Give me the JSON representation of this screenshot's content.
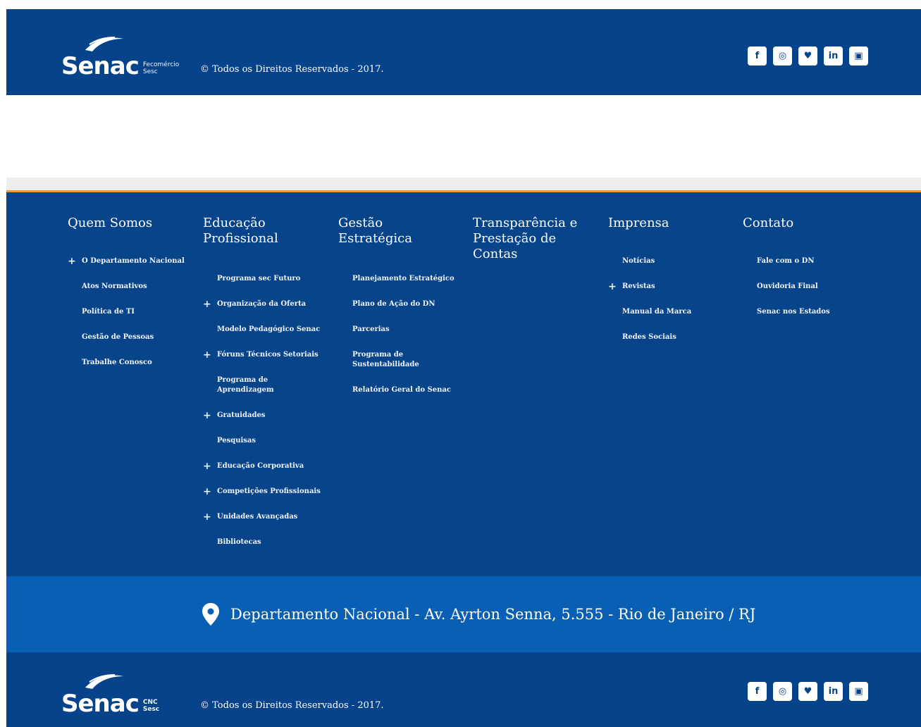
{
  "brand": {
    "name": "Senac",
    "top_sub": [
      "Fecomércio",
      "Sesc"
    ],
    "bottom_sub": [
      "CNC",
      "Sesc"
    ],
    "copyright": "© Todos os Direitos Reservados - 2017."
  },
  "social": [
    {
      "icon": "facebook-icon",
      "glyph": "f"
    },
    {
      "icon": "instagram-icon",
      "glyph": "◎"
    },
    {
      "icon": "twitter-icon",
      "glyph": "♥"
    },
    {
      "icon": "linkedin-icon",
      "glyph": "in"
    },
    {
      "icon": "youtube-icon",
      "glyph": "▣"
    }
  ],
  "colors": {
    "primary": "#06438a",
    "address_bar": "#085fb4",
    "accent": "#f39a31"
  },
  "columns": [
    {
      "title": "Quem Somos",
      "items": [
        {
          "label": "O Departamento Nacional",
          "expandable": true
        },
        {
          "label": "Atos Normativos",
          "expandable": false
        },
        {
          "label": "Política de TI",
          "expandable": false
        },
        {
          "label": "Gestão de Pessoas",
          "expandable": false
        },
        {
          "label": "Trabalhe Conosco",
          "expandable": false
        }
      ]
    },
    {
      "title": "Educação\nProfissional",
      "items": [
        {
          "label": "Programa sec Futuro",
          "expandable": false
        },
        {
          "label": "Organização da Oferta",
          "expandable": true
        },
        {
          "label": "Modelo Pedagógico Senac",
          "expandable": false
        },
        {
          "label": "Fóruns Técnicos Setoriais",
          "expandable": true
        },
        {
          "label": "Programa de\nAprendizagem",
          "expandable": false
        },
        {
          "label": "Gratuidades",
          "expandable": true
        },
        {
          "label": "Pesquisas",
          "expandable": false
        },
        {
          "label": "Educação Corporativa",
          "expandable": true
        },
        {
          "label": "Competições Profissionais",
          "expandable": true
        },
        {
          "label": "Unidades Avançadas",
          "expandable": true
        },
        {
          "label": "Bibliotecas",
          "expandable": false
        }
      ]
    },
    {
      "title": "Gestão\nEstratégica",
      "items": [
        {
          "label": "Planejamento Estratégico",
          "expandable": false
        },
        {
          "label": "Plano de Ação do DN",
          "expandable": false
        },
        {
          "label": "Parcerias",
          "expandable": false
        },
        {
          "label": "Programa de\nSustentabilidade",
          "expandable": false
        },
        {
          "label": "Relatório Geral do Senac",
          "expandable": false
        }
      ]
    },
    {
      "title": "Transparência e\nPrestação de\nContas",
      "items": []
    },
    {
      "title": "Imprensa",
      "items": [
        {
          "label": "Notícias",
          "expandable": false
        },
        {
          "label": "Revistas",
          "expandable": true
        },
        {
          "label": "Manual da Marca",
          "expandable": false
        },
        {
          "label": "Redes Sociais",
          "expandable": false
        }
      ]
    },
    {
      "title": "Contato",
      "items": [
        {
          "label": "Fale com o DN",
          "expandable": false
        },
        {
          "label": "Ouvidoria Final",
          "expandable": false
        },
        {
          "label": "Senac nos Estados",
          "expandable": false
        }
      ]
    }
  ],
  "address": "Departamento Nacional - Av. Ayrton Senna, 5.555 - Rio de Janeiro / RJ"
}
